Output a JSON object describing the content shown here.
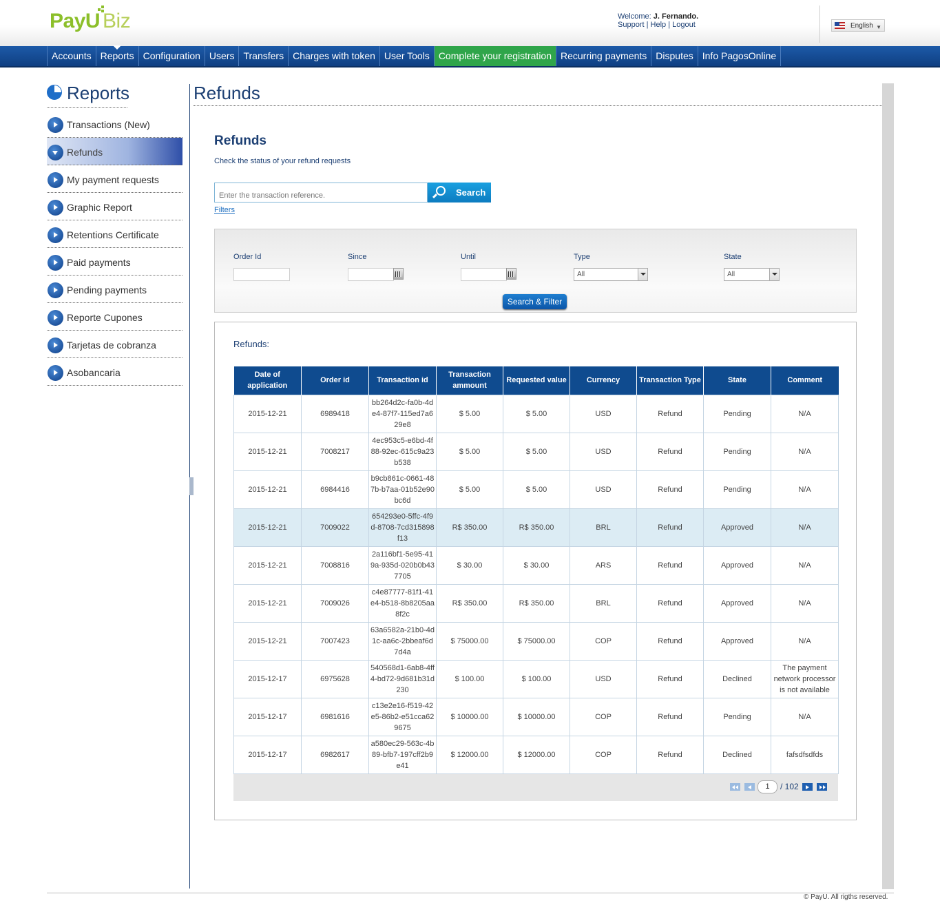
{
  "header": {
    "logo_main": "PayU",
    "logo_suffix": "Biz",
    "welcome_label": "Welcome:",
    "user_name": "J. Fernando.",
    "support": "Support",
    "help": "Help",
    "logout": "Logout",
    "sep": "|",
    "language": "English"
  },
  "nav": {
    "items": [
      "Accounts",
      "Reports",
      "Configuration",
      "Users",
      "Transfers",
      "Charges with token",
      "User Tools",
      "Complete your registration",
      "Recurring payments",
      "Disputes",
      "Info PagosOnline"
    ],
    "active": "Reports",
    "highlight": "Complete your registration",
    "highlight_color": "#2fa54a",
    "bar_color": "#0f3f82"
  },
  "sidebar": {
    "title": "Reports",
    "items": [
      "Transactions (New)",
      "Refunds",
      "My payment requests",
      "Graphic Report",
      "Retentions Certificate",
      "Paid payments",
      "Pending payments",
      "Reporte Cupones",
      "Tarjetas de cobranza",
      "Asobancaria"
    ],
    "active": "Refunds"
  },
  "main": {
    "title": "Refunds",
    "subtitle": "Refunds",
    "description": "Check the status of your refund requests",
    "search_placeholder": "Enter the transaction reference.",
    "search_button": "Search",
    "filters_link": "Filters"
  },
  "filters": {
    "order_id_label": "Order Id",
    "since_label": "Since",
    "until_label": "Until",
    "type_label": "Type",
    "type_value": "All",
    "state_label": "State",
    "state_value": "All",
    "button": "Search & Filter"
  },
  "results": {
    "label": "Refunds:",
    "columns": [
      "Date of application",
      "Order id",
      "Transaction id",
      "Transaction ammount",
      "Requested value",
      "Currency",
      "Transaction Type",
      "State",
      "Comment"
    ],
    "rows": [
      [
        "2015-12-21",
        "6989418",
        "bb264d2c-fa0b-4de4-87f7-115ed7a629e8",
        "$ 5.00",
        "$ 5.00",
        "USD",
        "Refund",
        "Pending",
        "N/A"
      ],
      [
        "2015-12-21",
        "7008217",
        "4ec953c5-e6bd-4f88-92ec-615c9a23b538",
        "$ 5.00",
        "$ 5.00",
        "USD",
        "Refund",
        "Pending",
        "N/A"
      ],
      [
        "2015-12-21",
        "6984416",
        "b9cb861c-0661-487b-b7aa-01b52e90bc6d",
        "$ 5.00",
        "$ 5.00",
        "USD",
        "Refund",
        "Pending",
        "N/A"
      ],
      [
        "2015-12-21",
        "7009022",
        "654293e0-5ffc-4f9d-8708-7cd315898f13",
        "R$ 350.00",
        "R$ 350.00",
        "BRL",
        "Refund",
        "Approved",
        "N/A"
      ],
      [
        "2015-12-21",
        "7008816",
        "2a116bf1-5e95-419a-935d-020b0b437705",
        "$ 30.00",
        "$ 30.00",
        "ARS",
        "Refund",
        "Approved",
        "N/A"
      ],
      [
        "2015-12-21",
        "7009026",
        "c4e87777-81f1-41e4-b518-8b8205aa8f2c",
        "R$ 350.00",
        "R$ 350.00",
        "BRL",
        "Refund",
        "Approved",
        "N/A"
      ],
      [
        "2015-12-21",
        "7007423",
        "63a6582a-21b0-4d1c-aa6c-2bbeaf6d7d4a",
        "$ 75000.00",
        "$ 75000.00",
        "COP",
        "Refund",
        "Approved",
        "N/A"
      ],
      [
        "2015-12-17",
        "6975628",
        "540568d1-6ab8-4ff4-bd72-9d681b31d230",
        "$ 100.00",
        "$ 100.00",
        "USD",
        "Refund",
        "Declined",
        "The payment network processor is not available"
      ],
      [
        "2015-12-17",
        "6981616",
        "c13e2e16-f519-42e5-86b2-e51cca629675",
        "$ 10000.00",
        "$ 10000.00",
        "COP",
        "Refund",
        "Pending",
        "N/A"
      ],
      [
        "2015-12-17",
        "6982617",
        "a580ec29-563c-4b89-bfb7-197cff2b9e41",
        "$ 12000.00",
        "$ 12000.00",
        "COP",
        "Refund",
        "Declined",
        "fafsdfsdfds"
      ]
    ],
    "highlighted_row_index": 3
  },
  "pager": {
    "current_page": "1",
    "total_pages": "/ 102",
    "icons": [
      "first-page-icon",
      "prev-page-icon",
      "next-page-icon",
      "last-page-icon"
    ]
  },
  "footer": {
    "copyright": "© PayU. All rigths reserved."
  }
}
